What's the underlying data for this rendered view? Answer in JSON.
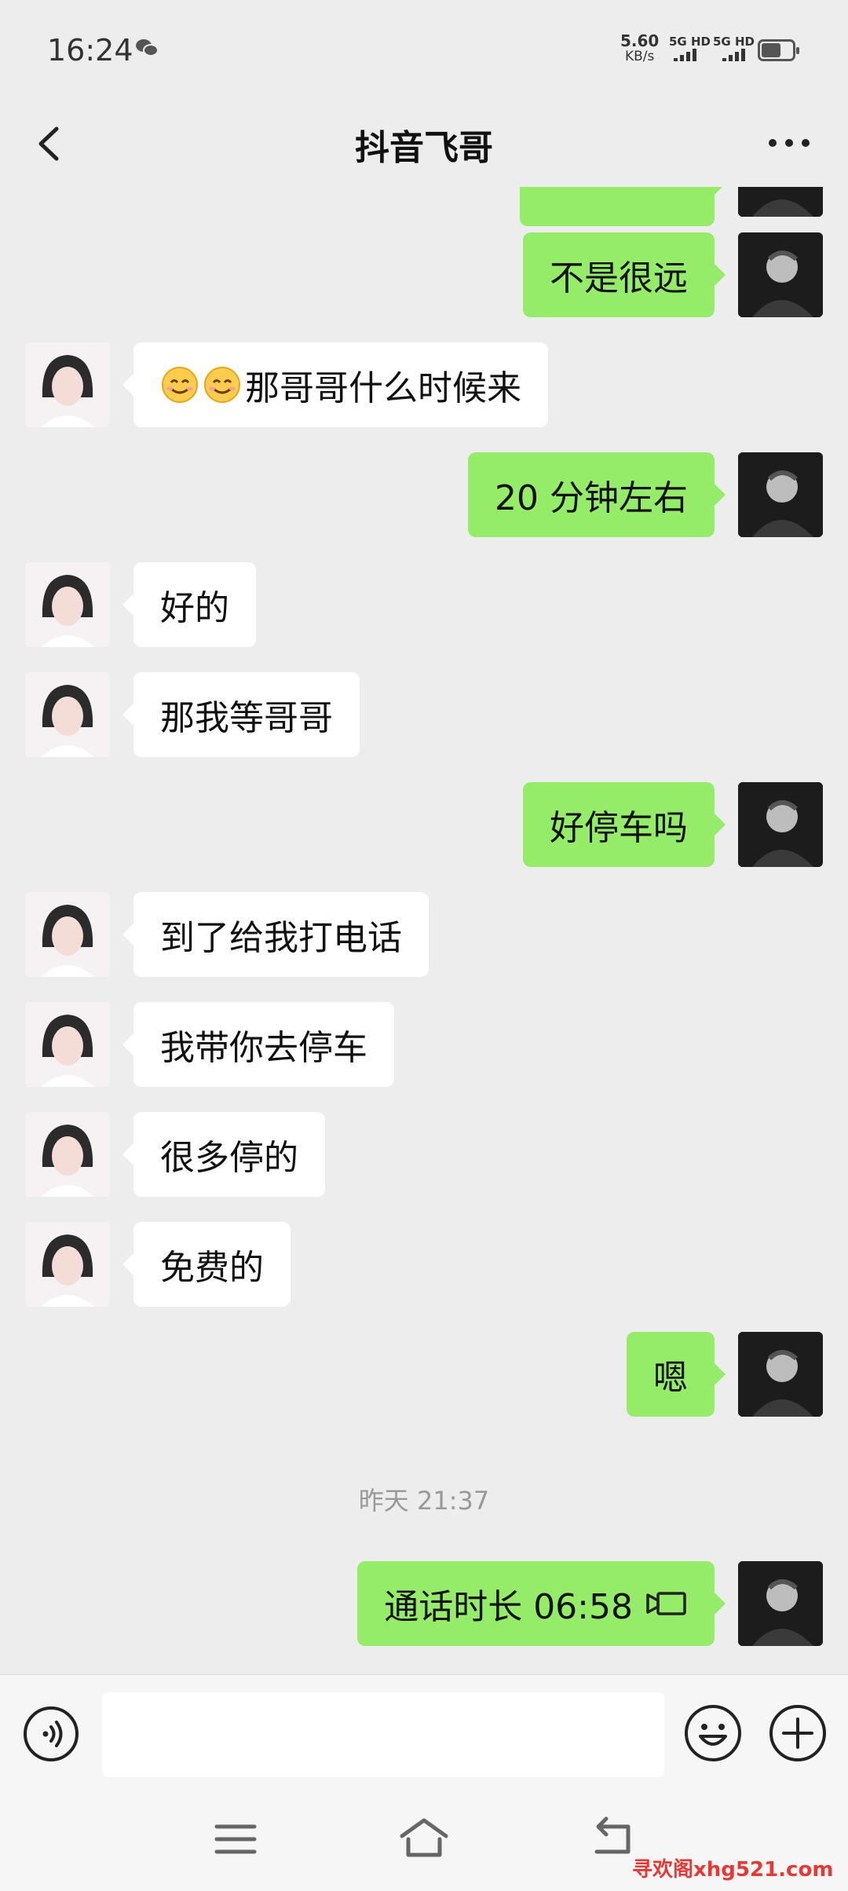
{
  "status_bar": {
    "time": "16:24",
    "net_speed": "5.60",
    "net_unit": "KB/s",
    "sim1": "5G HD",
    "sim2": "5G HD",
    "icons": [
      "wechat-icon",
      "signal-icon",
      "battery-icon"
    ]
  },
  "header": {
    "title": "抖音飞哥",
    "icons": [
      "back-icon",
      "more-icon"
    ]
  },
  "messages": [
    {
      "from": "me",
      "text": "不是很远"
    },
    {
      "from": "her",
      "emoji": [
        "smile-emoji",
        "smile-emoji"
      ],
      "text": "那哥哥什么时候来"
    },
    {
      "from": "me",
      "text": "20 分钟左右"
    },
    {
      "from": "her",
      "text": "好的"
    },
    {
      "from": "her",
      "text": "那我等哥哥"
    },
    {
      "from": "me",
      "text": "好停车吗"
    },
    {
      "from": "her",
      "text": "到了给我打电话"
    },
    {
      "from": "her",
      "text": "我带你去停车"
    },
    {
      "from": "her",
      "text": "很多停的"
    },
    {
      "from": "her",
      "text": "免费的"
    },
    {
      "from": "me",
      "text": "嗯"
    }
  ],
  "timestamp": "昨天 21:37",
  "call_message": {
    "from": "me",
    "text": "通话时长 06:58",
    "icon": "video-call-icon"
  },
  "input_bar": {
    "icons": [
      "voice-icon",
      "emoji-icon",
      "plus-icon"
    ],
    "placeholder": ""
  },
  "nav_bar": {
    "icons": [
      "menu-icon",
      "home-icon",
      "back-nav-icon"
    ]
  },
  "watermark": "寻欢阁xhg521.com",
  "colors": {
    "my_bubble": "#95ec69",
    "her_bubble": "#ffffff",
    "background": "#ededed"
  }
}
